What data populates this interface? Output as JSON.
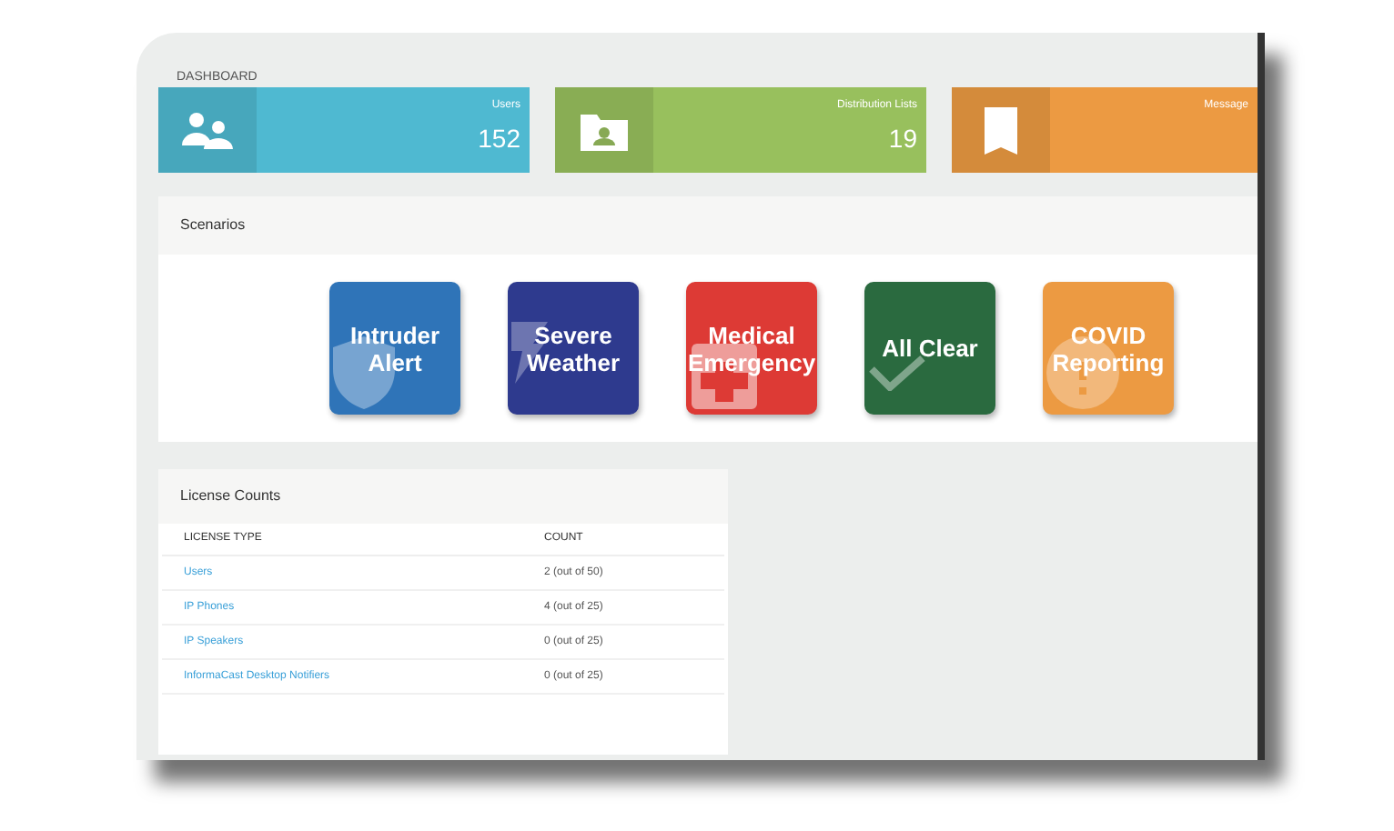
{
  "page_title": "DASHBOARD",
  "stats": [
    {
      "kind": "people",
      "label": "Users",
      "value": "152",
      "color": "#4fb9d1"
    },
    {
      "kind": "folder",
      "label": "Distribution Lists",
      "value": "19",
      "color": "#98c05d"
    },
    {
      "kind": "bookmark",
      "label": "Message",
      "color": "#ec9a42"
    }
  ],
  "scenarios": {
    "title": "Scenarios",
    "items": [
      {
        "kind": "shield",
        "label": "Intruder Alert",
        "color": "#2f74b8"
      },
      {
        "kind": "bolt",
        "label": "Severe Weather",
        "color": "#2e3a8e"
      },
      {
        "kind": "medical",
        "label": "Medical Emergency",
        "color": "#dd3a35"
      },
      {
        "kind": "check",
        "label": "All Clear",
        "color": "#2a6a3f"
      },
      {
        "kind": "alert",
        "label": "COVID Reporting",
        "color": "#ec9a42"
      }
    ]
  },
  "license_counts": {
    "title": "License Counts",
    "columns": [
      "LICENSE TYPE",
      "COUNT"
    ],
    "rows": [
      {
        "type": "Users",
        "count": "2 (out of 50)"
      },
      {
        "type": "IP Phones",
        "count": "4 (out of 25)"
      },
      {
        "type": "IP Speakers",
        "count": "0 (out of 25)"
      },
      {
        "type": "InformaCast Desktop Notifiers",
        "count": "0 (out of 25)"
      }
    ]
  }
}
